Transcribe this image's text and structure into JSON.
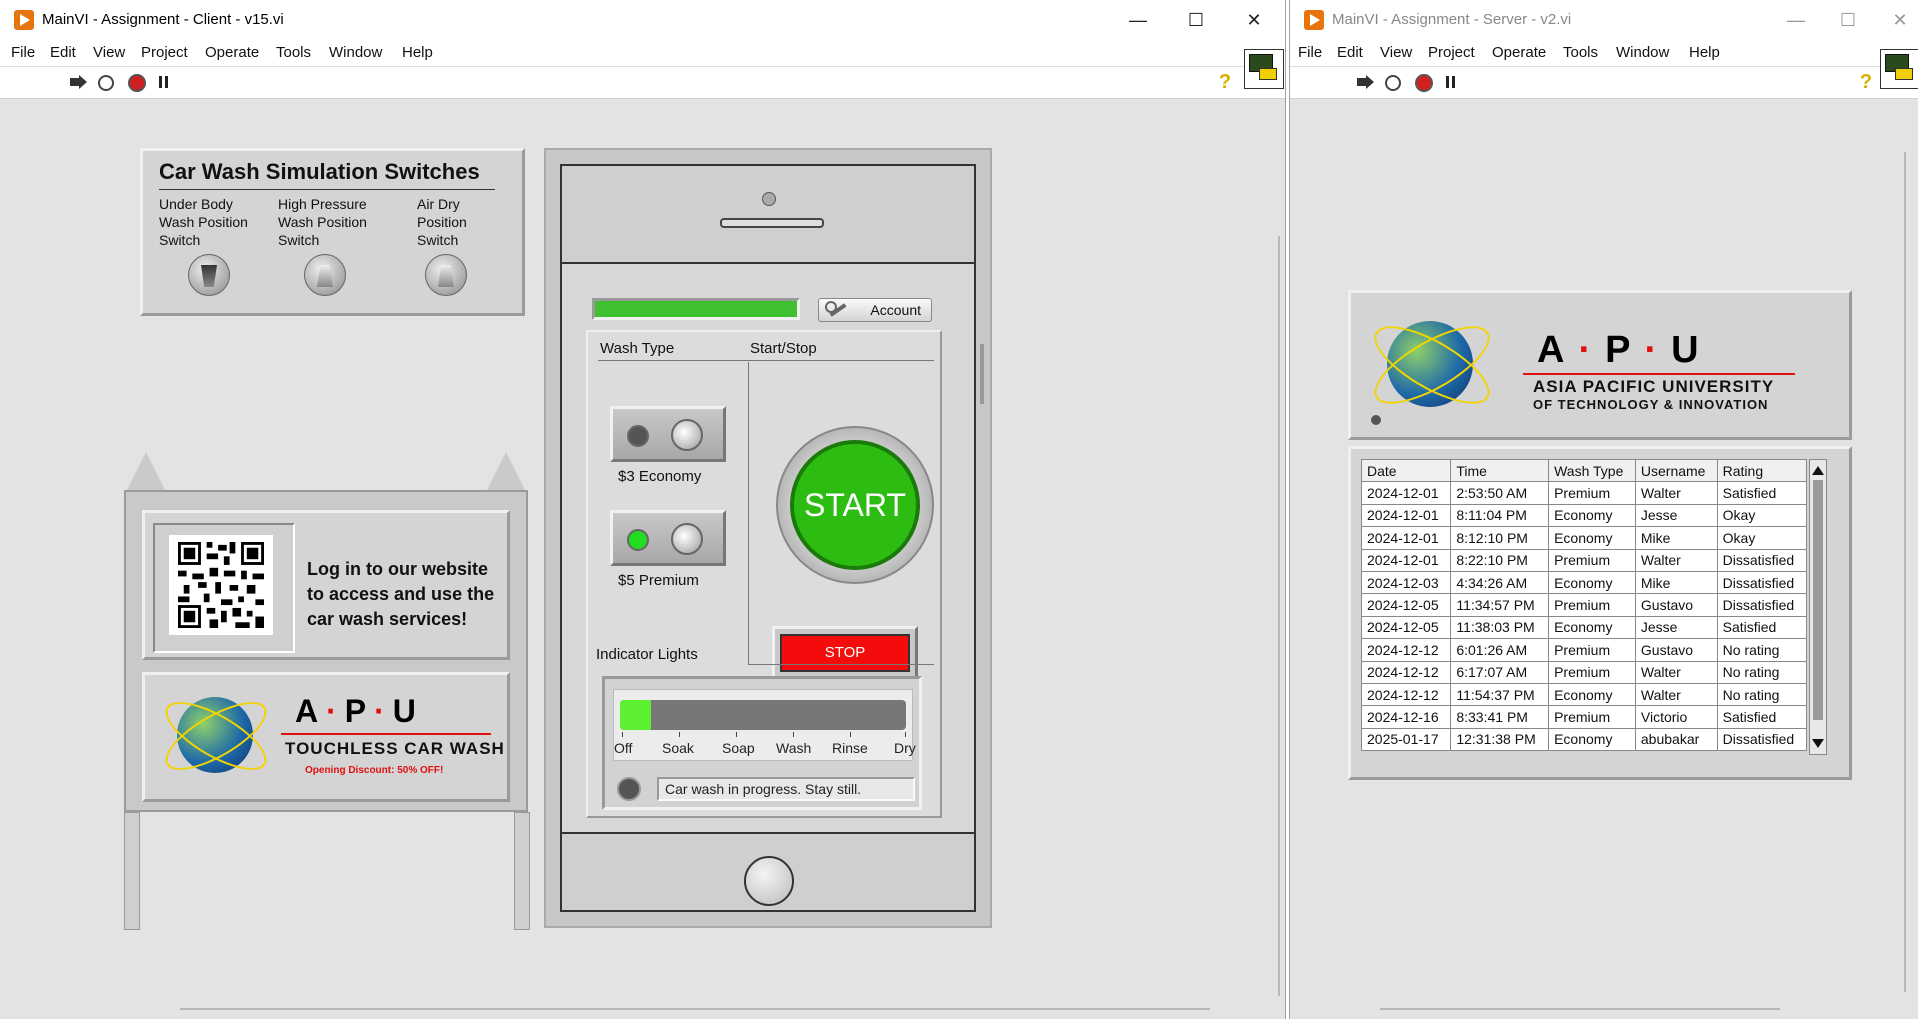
{
  "client": {
    "title": "MainVI - Assignment - Client - v15.vi",
    "window_buttons": {
      "minimize": "—",
      "maximize": "☐",
      "close": "✕"
    },
    "menu": [
      "File",
      "Edit",
      "View",
      "Project",
      "Operate",
      "Tools",
      "Window",
      "Help"
    ],
    "switches": {
      "title": "Car Wash Simulation Switches",
      "items": [
        {
          "label": "Under Body Wash Position Switch",
          "state": "down"
        },
        {
          "label": "High Pressure Wash Position Switch",
          "state": "up"
        },
        {
          "label": "Air Dry Position Switch",
          "state": "up"
        }
      ]
    },
    "sign": {
      "message": "Log in to our website to access and use the car wash services!",
      "brand_letters": [
        "A",
        "P",
        "U"
      ],
      "brand_sub": "TOUCHLESS CAR WASH",
      "discount": "Opening Discount: 50% OFF!"
    },
    "phone": {
      "account_label": "Account",
      "wash_type_label": "Wash Type",
      "start_stop_label": "Start/Stop",
      "options": [
        {
          "label": "$3 Economy",
          "selected": false,
          "led_color": "#555555"
        },
        {
          "label": "$5 Premium",
          "selected": true,
          "led_color": "#22dd22"
        }
      ],
      "start_label": "START",
      "stop_label": "STOP",
      "indicator_label": "Indicator Lights",
      "stages": [
        "Off",
        "Soak",
        "Soap",
        "Wash",
        "Rinse",
        "Dry"
      ],
      "stage_progress_fraction": 0.11,
      "status_text": "Car wash in progress. Stay still."
    }
  },
  "server": {
    "title": "MainVI - Assignment - Server - v2.vi",
    "window_buttons": {
      "minimize": "—",
      "maximize": "☐",
      "close": "✕"
    },
    "menu": [
      "File",
      "Edit",
      "View",
      "Project",
      "Operate",
      "Tools",
      "Window",
      "Help"
    ],
    "logo": {
      "letters": [
        "A",
        "P",
        "U"
      ],
      "line1": "ASIA PACIFIC UNIVERSITY",
      "line2": "OF TECHNOLOGY & INNOVATION"
    },
    "table": {
      "columns": [
        "Date",
        "Time",
        "Wash Type",
        "Username",
        "Rating"
      ],
      "rows": [
        [
          "2024-12-01",
          "2:53:50 AM",
          "Premium",
          "Walter",
          "Satisfied"
        ],
        [
          "2024-12-01",
          "8:11:04 PM",
          "Economy",
          "Jesse",
          "Okay"
        ],
        [
          "2024-12-01",
          "8:12:10 PM",
          "Economy",
          "Mike",
          "Okay"
        ],
        [
          "2024-12-01",
          "8:22:10 PM",
          "Premium",
          "Walter",
          "Dissatisfied"
        ],
        [
          "2024-12-03",
          "4:34:26 AM",
          "Economy",
          "Mike",
          "Dissatisfied"
        ],
        [
          "2024-12-05",
          "11:34:57 PM",
          "Premium",
          "Gustavo",
          "Dissatisfied"
        ],
        [
          "2024-12-05",
          "11:38:03 PM",
          "Economy",
          "Jesse",
          "Satisfied"
        ],
        [
          "2024-12-12",
          "6:01:26 AM",
          "Premium",
          "Gustavo",
          "No rating"
        ],
        [
          "2024-12-12",
          "6:17:07 AM",
          "Premium",
          "Walter",
          "No rating"
        ],
        [
          "2024-12-12",
          "11:54:37 PM",
          "Economy",
          "Walter",
          "No rating"
        ],
        [
          "2024-12-16",
          "8:33:41 PM",
          "Premium",
          "Victorio",
          "Satisfied"
        ],
        [
          "2025-01-17",
          "12:31:38 PM",
          "Economy",
          "abubakar",
          "Dissatisfied"
        ]
      ]
    }
  },
  "colors": {
    "start_green": "#2dbd12",
    "stop_red": "#f40c0c",
    "progress_green": "#3fc030",
    "brand_red": "#e01010"
  }
}
